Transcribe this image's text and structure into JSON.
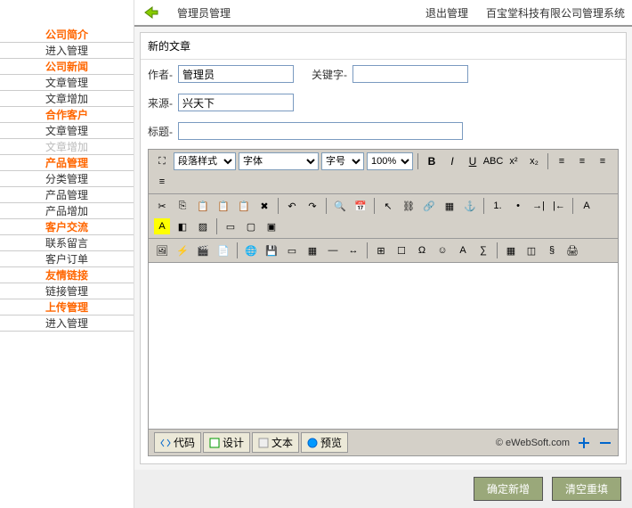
{
  "topbar": {
    "admin": "管理员管理",
    "logout": "退出管理",
    "system": "百宝堂科技有限公司管理系统"
  },
  "sidebar": [
    "公司简介",
    "进入管理",
    "公司新闻",
    "文章管理",
    "文章增加",
    "合作客户",
    "文章管理",
    "文章增加",
    "产品管理",
    "分类管理",
    "产品管理",
    "产品增加",
    "客户交流",
    "联系留言",
    "客户订单",
    "友情链接",
    "链接管理",
    "上传管理",
    "进入管理"
  ],
  "form": {
    "panel_title": "新的文章",
    "author_label": "作者-",
    "author_value": "管理员",
    "keyword_label": "关键字-",
    "source_label": "来源-",
    "source_value": "兴天下",
    "title_label": "标题-"
  },
  "editor": {
    "paragraph": "段落样式",
    "font": "字体",
    "size": "字号",
    "zoom": "100%",
    "modes": [
      "代码",
      "设计",
      "文本",
      "预览"
    ],
    "credit": "© eWebSoft.com"
  },
  "actions": {
    "submit": "确定新增",
    "reset": "清空重填"
  }
}
